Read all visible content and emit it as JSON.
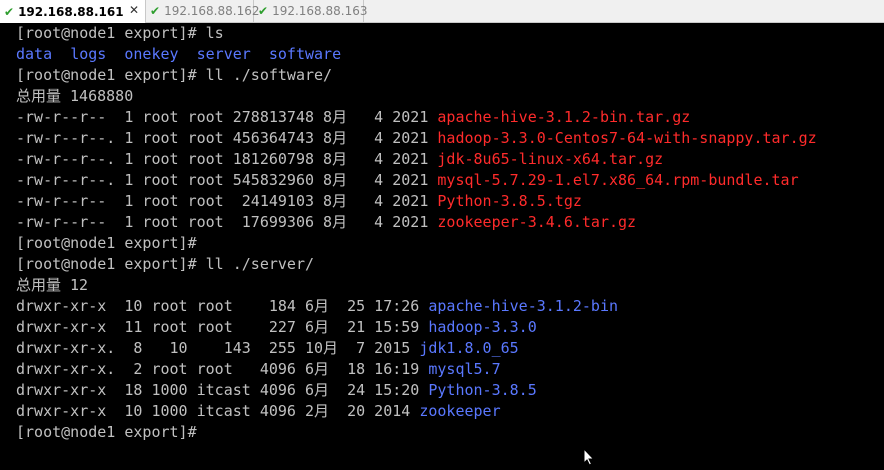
{
  "tabs": [
    {
      "label": "192.168.88.161",
      "active": true
    },
    {
      "label": "192.168.88.162",
      "active": false
    },
    {
      "label": "192.168.88.163",
      "active": false
    }
  ],
  "terminal": {
    "lines": [
      {
        "prompt": "[root@node1 export]# ",
        "cmd": "ls"
      },
      {
        "dirs": [
          "data",
          "logs",
          "onekey",
          "server",
          "software"
        ]
      },
      {
        "prompt": "[root@node1 export]# ",
        "cmd": "ll ./software/"
      },
      {
        "text": "总用量 1468880"
      },
      {
        "meta": "-rw-r--r--  1 root root 278813748 8月   4 2021 ",
        "name": "apache-hive-3.1.2-bin.tar.gz",
        "color": "red"
      },
      {
        "meta": "-rw-r--r--. 1 root root 456364743 8月   4 2021 ",
        "name": "hadoop-3.3.0-Centos7-64-with-snappy.tar.gz",
        "color": "red"
      },
      {
        "meta": "-rw-r--r--. 1 root root 181260798 8月   4 2021 ",
        "name": "jdk-8u65-linux-x64.tar.gz",
        "color": "red"
      },
      {
        "meta": "-rw-r--r--. 1 root root 545832960 8月   4 2021 ",
        "name": "mysql-5.7.29-1.el7.x86_64.rpm-bundle.tar",
        "color": "red"
      },
      {
        "meta": "-rw-r--r--  1 root root  24149103 8月   4 2021 ",
        "name": "Python-3.8.5.tgz",
        "color": "red"
      },
      {
        "meta": "-rw-r--r--  1 root root  17699306 8月   4 2021 ",
        "name": "zookeeper-3.4.6.tar.gz",
        "color": "red"
      },
      {
        "prompt": "[root@node1 export]#",
        "cmd": ""
      },
      {
        "prompt": "[root@node1 export]# ",
        "cmd": "ll ./server/"
      },
      {
        "text": "总用量 12"
      },
      {
        "meta": "drwxr-xr-x  10 root root    184 6月  25 17:26 ",
        "name": "apache-hive-3.1.2-bin",
        "color": "blue"
      },
      {
        "meta": "drwxr-xr-x  11 root root    227 6月  21 15:59 ",
        "name": "hadoop-3.3.0",
        "color": "blue"
      },
      {
        "meta": "drwxr-xr-x.  8   10    143  255 10月  7 2015 ",
        "name": "jdk1.8.0_65",
        "color": "blue"
      },
      {
        "meta": "drwxr-xr-x.  2 root root   4096 6月  18 16:19 ",
        "name": "mysql5.7",
        "color": "blue"
      },
      {
        "meta": "drwxr-xr-x  18 1000 itcast 4096 6月  24 15:20 ",
        "name": "Python-3.8.5",
        "color": "blue"
      },
      {
        "meta": "drwxr-xr-x  10 1000 itcast 4096 2月  20 2014 ",
        "name": "zookeeper",
        "color": "blue"
      },
      {
        "prompt": "[root@node1 export]#",
        "cmd": "",
        "cursor": true
      }
    ]
  },
  "icons": {
    "tab_status": "check-icon",
    "tab_close": "close-icon",
    "pointer": "mouse-pointer-icon"
  }
}
